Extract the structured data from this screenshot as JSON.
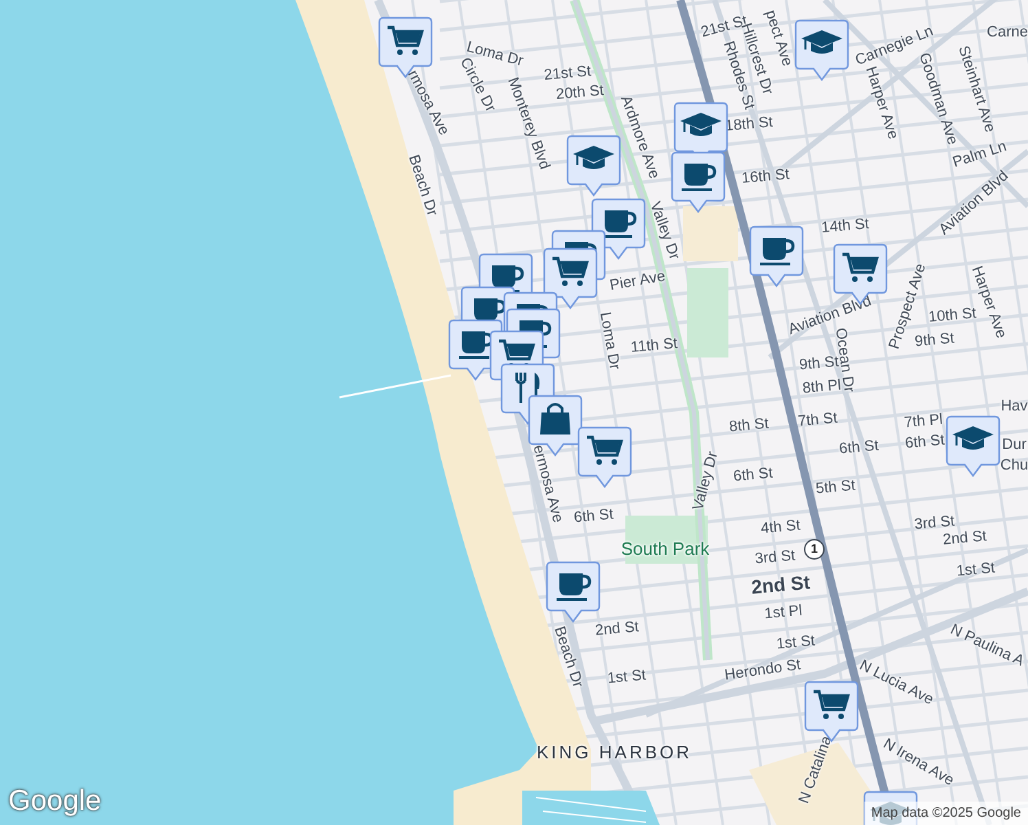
{
  "map": {
    "labels": [
      {
        "text": "Loma Dr",
        "kind": "street"
      },
      {
        "text": "Circle Dr",
        "kind": "street"
      },
      {
        "text": "Monterey Blvd",
        "kind": "street"
      },
      {
        "text": "21st St",
        "kind": "street"
      },
      {
        "text": "20th St",
        "kind": "street"
      },
      {
        "text": "rmosa Ave",
        "kind": "street"
      },
      {
        "text": "Beach Dr",
        "kind": "street"
      },
      {
        "text": "Ardmore Ave",
        "kind": "street"
      },
      {
        "text": "Valley Dr",
        "kind": "street"
      },
      {
        "text": "Pier Ave",
        "kind": "street"
      },
      {
        "text": "Loma Dr",
        "kind": "street"
      },
      {
        "text": "11th St",
        "kind": "street"
      },
      {
        "text": "ermosa Ave",
        "kind": "street"
      },
      {
        "text": "6th St",
        "kind": "street"
      },
      {
        "text": "South Park",
        "kind": "park"
      },
      {
        "text": "Valley Dr",
        "kind": "street"
      },
      {
        "text": "2nd St",
        "kind": "street"
      },
      {
        "text": "1st St",
        "kind": "street"
      },
      {
        "text": "Beach Dr",
        "kind": "street"
      },
      {
        "text": "KING HARBOR",
        "kind": "area"
      },
      {
        "text": "Herondo St",
        "kind": "street"
      },
      {
        "text": "pect Ave",
        "kind": "street"
      },
      {
        "text": "21st St",
        "kind": "street"
      },
      {
        "text": "Hillcrest Dr",
        "kind": "street"
      },
      {
        "text": "Rhodes St",
        "kind": "street"
      },
      {
        "text": "18th St",
        "kind": "street"
      },
      {
        "text": "16th St",
        "kind": "street"
      },
      {
        "text": "14th St",
        "kind": "street"
      },
      {
        "text": "Carnegie Ln",
        "kind": "street"
      },
      {
        "text": "Harper Ave",
        "kind": "street"
      },
      {
        "text": "Goodman Ave",
        "kind": "street"
      },
      {
        "text": "Steinhart Ave",
        "kind": "street"
      },
      {
        "text": "Palm Ln",
        "kind": "street"
      },
      {
        "text": "Aviation Blvd",
        "kind": "street"
      },
      {
        "text": "Aviation Blvd",
        "kind": "street"
      },
      {
        "text": "Prospect Ave",
        "kind": "street"
      },
      {
        "text": "Harper Ave",
        "kind": "street"
      },
      {
        "text": "10th St",
        "kind": "street"
      },
      {
        "text": "9th St",
        "kind": "street"
      },
      {
        "text": "9th St",
        "kind": "street"
      },
      {
        "text": "8th Pl",
        "kind": "street"
      },
      {
        "text": "Ocean Dr",
        "kind": "street"
      },
      {
        "text": "8th St",
        "kind": "street"
      },
      {
        "text": "7th St",
        "kind": "street"
      },
      {
        "text": "6th St",
        "kind": "street"
      },
      {
        "text": "5th St",
        "kind": "street"
      },
      {
        "text": "4th St",
        "kind": "street"
      },
      {
        "text": "3rd St",
        "kind": "street"
      },
      {
        "text": "2nd St",
        "kind": "major"
      },
      {
        "text": "1st Pl",
        "kind": "street"
      },
      {
        "text": "1st St",
        "kind": "street"
      },
      {
        "text": "7th Pl",
        "kind": "street"
      },
      {
        "text": "6th St",
        "kind": "street"
      },
      {
        "text": "3rd St",
        "kind": "street"
      },
      {
        "text": "2nd St",
        "kind": "street"
      },
      {
        "text": "1st St",
        "kind": "street"
      },
      {
        "text": "N Paulina A",
        "kind": "street"
      },
      {
        "text": "N Lucia Ave",
        "kind": "street"
      },
      {
        "text": "N Irena Ave",
        "kind": "street"
      },
      {
        "text": "N Catalina",
        "kind": "street"
      },
      {
        "text": "Carne",
        "kind": "street"
      },
      {
        "text": "Hav",
        "kind": "street"
      },
      {
        "text": "Dur",
        "kind": "place"
      },
      {
        "text": "Chu",
        "kind": "place"
      },
      {
        "text": "6th St",
        "kind": "street"
      }
    ],
    "route_shield": "1",
    "markers": [
      {
        "kind": "cart"
      },
      {
        "kind": "cap"
      },
      {
        "kind": "cap"
      },
      {
        "kind": "cup"
      },
      {
        "kind": "cup"
      },
      {
        "kind": "cup"
      },
      {
        "kind": "cart"
      },
      {
        "kind": "cup"
      },
      {
        "kind": "cap"
      },
      {
        "kind": "cup"
      },
      {
        "kind": "cart"
      },
      {
        "kind": "cup"
      },
      {
        "kind": "cup"
      },
      {
        "kind": "cup"
      },
      {
        "kind": "cup"
      },
      {
        "kind": "cart"
      },
      {
        "kind": "fork"
      },
      {
        "kind": "bag"
      },
      {
        "kind": "cart"
      },
      {
        "kind": "cup"
      },
      {
        "kind": "cap"
      },
      {
        "kind": "cart"
      },
      {
        "kind": "cap"
      }
    ],
    "logo": "Google",
    "attribution": "Map data ©2025 Google"
  }
}
